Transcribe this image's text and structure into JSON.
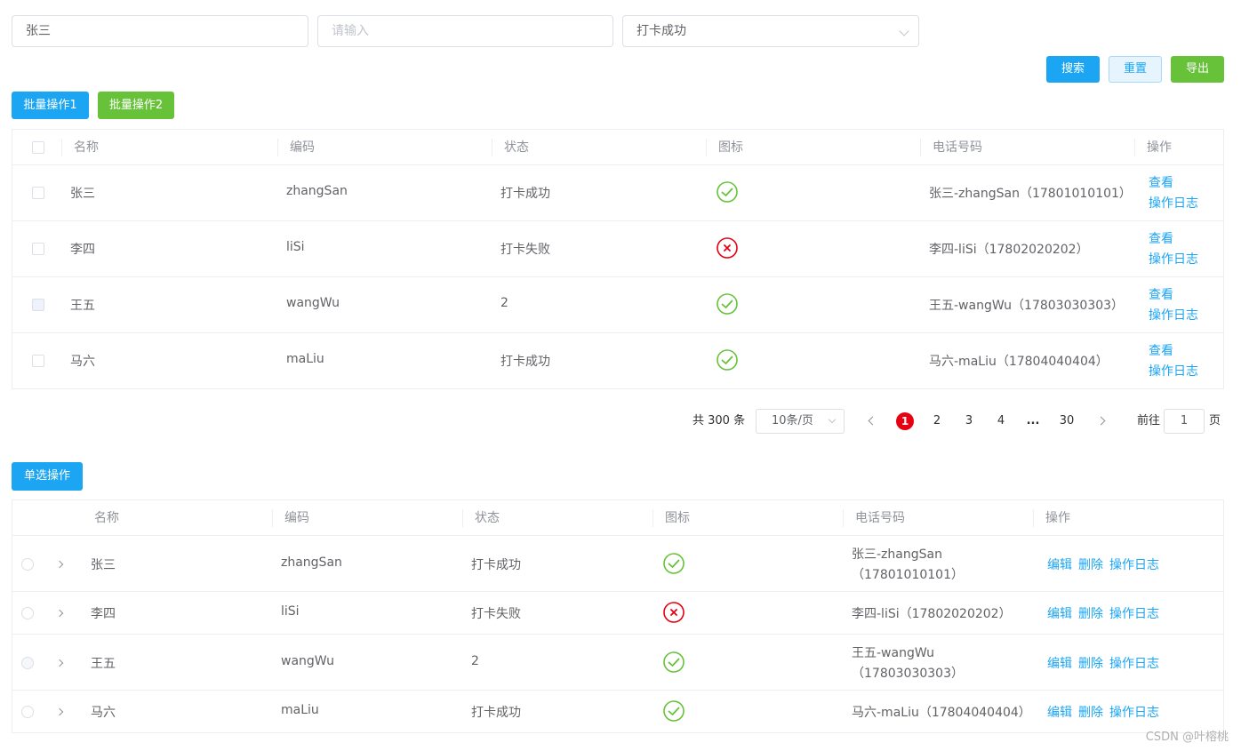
{
  "filters": {
    "name_value": "张三",
    "code_placeholder": "请输入",
    "status_value": "打卡成功"
  },
  "toolbar": {
    "search_label": "搜索",
    "reset_label": "重置",
    "export_label": "导出",
    "batch1_label": "批量操作1",
    "batch2_label": "批量操作2",
    "single_label": "单选操作"
  },
  "colors": {
    "primary": "#1ba5f2",
    "success": "#67c23a",
    "danger": "#e60012"
  },
  "table1": {
    "headers": [
      "名称",
      "编码",
      "状态",
      "图标",
      "电话号码",
      "操作"
    ],
    "rows": [
      {
        "name": "张三",
        "code": "zhangSan",
        "status": "打卡成功",
        "icon": "check-circle-icon",
        "phone": "张三-zhangSan（17801010101）",
        "actions": [
          "查看",
          "操作日志"
        ]
      },
      {
        "name": "李四",
        "code": "liSi",
        "status": "打卡失败",
        "icon": "close-circle-icon",
        "phone": "李四-liSi（17802020202）",
        "actions": [
          "查看",
          "操作日志"
        ]
      },
      {
        "name": "王五",
        "code": "wangWu",
        "status": "2",
        "icon": "check-circle-icon",
        "phone": "王五-wangWu（17803030303）",
        "actions": [
          "查看",
          "操作日志"
        ]
      },
      {
        "name": "马六",
        "code": "maLiu",
        "status": "打卡成功",
        "icon": "check-circle-icon",
        "phone": "马六-maLiu（17804040404）",
        "actions": [
          "查看",
          "操作日志"
        ]
      }
    ]
  },
  "pagination": {
    "total_text": "共 300 条",
    "page_size": "10条/页",
    "pages": [
      "1",
      "2",
      "3",
      "4",
      "...",
      "30"
    ],
    "current": "1",
    "goto_prefix": "前往",
    "goto_value": "1",
    "goto_suffix": "页"
  },
  "table2": {
    "headers": [
      "名称",
      "编码",
      "状态",
      "图标",
      "电话号码",
      "操作"
    ],
    "rows": [
      {
        "name": "张三",
        "code": "zhangSan",
        "status": "打卡成功",
        "icon": "check-circle-icon",
        "phone_line1": "张三-zhangSan",
        "phone_line2": "（17801010101）",
        "actions": [
          "编辑",
          "删除",
          "操作日志"
        ]
      },
      {
        "name": "李四",
        "code": "liSi",
        "status": "打卡失败",
        "icon": "close-circle-icon",
        "phone_line1": "李四-liSi（17802020202）",
        "phone_line2": "",
        "actions": [
          "编辑",
          "删除",
          "操作日志"
        ]
      },
      {
        "name": "王五",
        "code": "wangWu",
        "status": "2",
        "icon": "check-circle-icon",
        "phone_line1": "王五-wangWu",
        "phone_line2": "（17803030303）",
        "actions": [
          "编辑",
          "删除",
          "操作日志"
        ]
      },
      {
        "name": "马六",
        "code": "maLiu",
        "status": "打卡成功",
        "icon": "check-circle-icon",
        "phone_line1": "马六-maLiu（17804040404）",
        "phone_line2": "",
        "actions": [
          "编辑",
          "删除",
          "操作日志"
        ]
      }
    ]
  },
  "watermark": "CSDN @叶榕桃"
}
